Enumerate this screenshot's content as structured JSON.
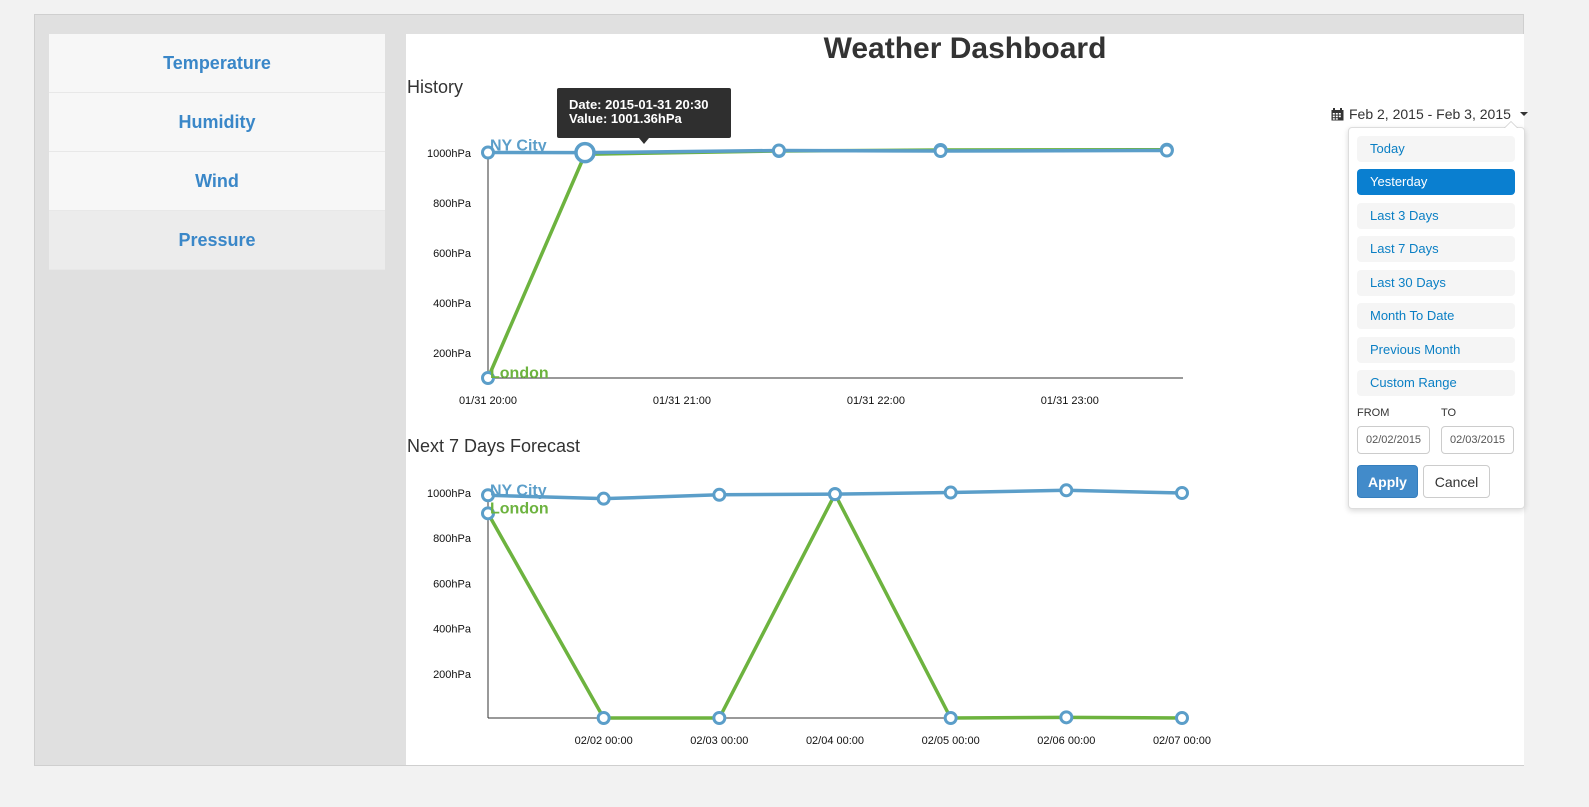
{
  "app": {
    "title": "Weather Dashboard"
  },
  "sidebar": {
    "items": [
      {
        "label": "Temperature"
      },
      {
        "label": "Humidity"
      },
      {
        "label": "Wind"
      },
      {
        "label": "Pressure",
        "active": true
      }
    ]
  },
  "sections": {
    "history": "History",
    "forecast": "Next 7 Days Forecast"
  },
  "tooltip": {
    "date": "Date: 2015-01-31 20:30",
    "value": "Value: 1001.36hPa"
  },
  "daterange": {
    "label": "Feb 2, 2015 - Feb 3, 2015",
    "options": [
      "Today",
      "Yesterday",
      "Last 3 Days",
      "Last 7 Days",
      "Last 30 Days",
      "Month To Date",
      "Previous Month",
      "Custom Range"
    ],
    "selected": "Yesterday",
    "from_label": "FROM",
    "to_label": "TO",
    "from_value": "02/02/2015",
    "to_value": "02/03/2015",
    "apply_label": "Apply",
    "cancel_label": "Cancel"
  },
  "colors": {
    "ny": "#5b9ec9",
    "london": "#6db33f",
    "accent": "#0a7fd0",
    "link": "#3a87c8"
  },
  "chart_data": [
    {
      "type": "line",
      "title": "History",
      "xlabel": "",
      "ylabel": "",
      "y_ticks": [
        "200hPa",
        "400hPa",
        "600hPa",
        "800hPa",
        "1000hPa"
      ],
      "x_ticks": [
        "01/31 20:00",
        "01/31 21:00",
        "01/31 22:00",
        "01/31 23:00"
      ],
      "series": [
        {
          "name": "NY City",
          "x": [
            "01/31 20:00",
            "01/31 20:30",
            "01/31 21:30",
            "01/31 22:20",
            "01/31 23:30"
          ],
          "values": [
            1002,
            1001.36,
            1010,
            1008,
            1010
          ]
        },
        {
          "name": "London",
          "x": [
            "01/31 20:00",
            "01/31 20:30",
            "01/31 21:30",
            "01/31 22:20",
            "01/31 23:30"
          ],
          "values": [
            100,
            995,
            1008,
            1012,
            1013
          ]
        }
      ]
    },
    {
      "type": "line",
      "title": "Next 7 Days Forecast",
      "xlabel": "",
      "ylabel": "",
      "y_ticks": [
        "200hPa",
        "400hPa",
        "600hPa",
        "800hPa",
        "1000hPa"
      ],
      "x_ticks": [
        "02/02 00:00",
        "02/03 00:00",
        "02/04 00:00",
        "02/05 00:00",
        "02/06 00:00",
        "02/07 00:00"
      ],
      "series": [
        {
          "name": "NY City",
          "x": [
            "02/01 00:00",
            "02/02 00:00",
            "02/03 00:00",
            "02/04 00:00",
            "02/05 00:00",
            "02/06 00:00",
            "02/07 00:00"
          ],
          "values": [
            990,
            975,
            992,
            995,
            1002,
            1012,
            1000
          ]
        },
        {
          "name": "London",
          "x": [
            "02/01 00:00",
            "02/02 00:00",
            "02/03 00:00",
            "02/04 00:00",
            "02/05 00:00",
            "02/06 00:00",
            "02/07 00:00"
          ],
          "values": [
            910,
            5,
            5,
            995,
            5,
            8,
            5
          ]
        }
      ]
    }
  ]
}
